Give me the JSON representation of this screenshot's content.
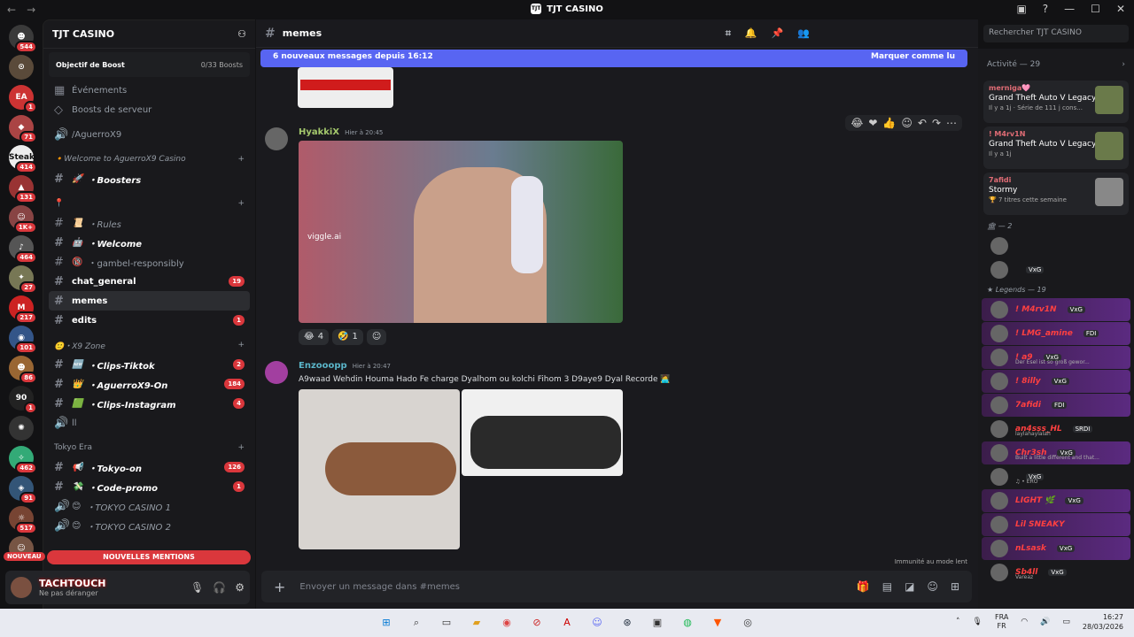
{
  "window": {
    "title": "TJT CASINO"
  },
  "servers": [
    {
      "label": "☻",
      "badge": "544",
      "color": "#3a3a3a"
    },
    {
      "label": "⊙",
      "badge": "",
      "color": "#5a4a3a"
    },
    {
      "label": "EA",
      "badge": "1",
      "color": "#c33"
    },
    {
      "label": "◆",
      "badge": "71",
      "color": "#a44"
    },
    {
      "label": "Steak",
      "badge": "414",
      "color": "#eee"
    },
    {
      "label": "▲",
      "badge": "131",
      "color": "#933"
    },
    {
      "label": "☺",
      "badge": "1K+",
      "color": "#844"
    },
    {
      "label": "♪",
      "badge": "464",
      "color": "#555"
    },
    {
      "label": "✦",
      "badge": "27",
      "color": "#775"
    },
    {
      "label": "M",
      "badge": "217",
      "color": "#c22"
    },
    {
      "label": "◉",
      "badge": "101",
      "color": "#358"
    },
    {
      "label": "☻",
      "badge": "86",
      "color": "#963"
    },
    {
      "label": "90",
      "badge": "1",
      "color": "#222"
    },
    {
      "label": "✺",
      "badge": "",
      "color": "#333"
    },
    {
      "label": "✧",
      "badge": "462",
      "color": "#3a7"
    },
    {
      "label": "◈",
      "badge": "91",
      "color": "#357"
    },
    {
      "label": "☼",
      "badge": "517",
      "color": "#743"
    },
    {
      "label": "☺",
      "badge": "",
      "color": "#754"
    }
  ],
  "guild": {
    "name": "TJT CASINO",
    "boost_label": "Objectif de Boost",
    "boost_count": "0/33 Boosts",
    "events": "Événements",
    "boosts": "Boosts de serveur",
    "voice": "/AguerroX9"
  },
  "sections": [
    {
      "category": "🔸Welcome to AguerroX9 Casino",
      "cat_italic": true,
      "channels": [
        {
          "icon": "🚀",
          "name": "・Boosters",
          "bold": true,
          "italic": true,
          "count": ""
        }
      ]
    },
    {
      "category": "📍",
      "cat_italic": false,
      "channels": [
        {
          "icon": "📜",
          "name": "・Rules",
          "bold": false,
          "italic": true,
          "count": ""
        },
        {
          "icon": "🤖",
          "name": "・Welcome",
          "bold": true,
          "italic": true,
          "count": ""
        },
        {
          "icon": "🔞",
          "name": "・gambel-responsibly",
          "bold": false,
          "italic": false,
          "count": ""
        },
        {
          "icon": "",
          "name": "chat_general",
          "bold": true,
          "italic": false,
          "count": "19"
        },
        {
          "icon": "",
          "name": "memes",
          "bold": true,
          "italic": false,
          "count": "",
          "selected": true
        },
        {
          "icon": "",
          "name": "edits",
          "bold": true,
          "italic": false,
          "count": "1"
        }
      ]
    },
    {
      "category": "🙂・X9 Zone",
      "cat_italic": true,
      "channels": [
        {
          "icon": "🆕",
          "name": "・Clips-Tiktok",
          "bold": true,
          "italic": true,
          "count": "2"
        },
        {
          "icon": "👑",
          "name": "・AguerroX9-On",
          "bold": true,
          "italic": true,
          "count": "184"
        },
        {
          "icon": "🟩",
          "name": "・Clips-Instagram",
          "bold": true,
          "italic": true,
          "count": "4"
        },
        {
          "icon": "",
          "name": "ll",
          "bold": false,
          "italic": false,
          "count": ""
        }
      ]
    },
    {
      "category": "Tokyo Era",
      "cat_italic": false,
      "channels": [
        {
          "icon": "📢",
          "name": "・Tokyo-on",
          "bold": true,
          "italic": true,
          "count": "126"
        },
        {
          "icon": "💸",
          "name": "・Code-promo",
          "bold": true,
          "italic": true,
          "count": "1"
        },
        {
          "icon": "😊",
          "name": "・TOKYO CASINO 1",
          "bold": false,
          "italic": true,
          "count": ""
        },
        {
          "icon": "😊",
          "name": "・TOKYO CASINO 2",
          "bold": false,
          "italic": true,
          "count": ""
        }
      ]
    }
  ],
  "mentions": {
    "nouveau": "NOUVEAU",
    "label": "NOUVELLES MENTIONS"
  },
  "user": {
    "name": "TACHTOUCH",
    "status": "Ne pas déranger"
  },
  "channel": {
    "name": "memes",
    "search_placeholder": "Rechercher TJT CASINO"
  },
  "newbar": {
    "text": "6 nouveaux messages depuis 16:12",
    "action": "Marquer comme lu"
  },
  "messages": [
    {
      "author": "HyakkiX",
      "time": "Hier à 20:45",
      "reactions": [
        {
          "e": "😂",
          "n": "4"
        },
        {
          "e": "🤣",
          "n": "1"
        },
        {
          "e": "☺",
          "n": ""
        }
      ],
      "watermark": "viggle.ai"
    },
    {
      "author": "Enzooopp",
      "time": "Hier à 20:47",
      "text": "A9waad Wehdin Houma Hado Fe charge Dyalhom ou kolchi Fihom 3 D9aye9 Dyal Recorde 🧑‍💻"
    }
  ],
  "composer": {
    "placeholder": "Envoyer un message dans #memes",
    "immunity": "Immunité au mode lent"
  },
  "activity": {
    "header": "Activité — 29",
    "cards": [
      {
        "who": "merniga🩷",
        "title": "Grand Theft Auto V Legacy",
        "sub": "Il y a 1j · Série de 111 j cons...",
        "thumb": "#6a7a4a"
      },
      {
        "who": "! M4rv1N",
        "title": "Grand Theft Auto V Legacy",
        "sub": "Il y a 1j",
        "thumb": "#6a7a4a"
      },
      {
        "who": "7afidi",
        "title": "Stormy",
        "sub": "🏆 7 titres cette semaine",
        "thumb": "#888"
      }
    ]
  },
  "groups": [
    {
      "label": "🏛 — 2",
      "members": [
        {
          "name": "",
          "tag": "",
          "status": ""
        },
        {
          "name": "",
          "tag": "VxG",
          "status": ""
        }
      ]
    },
    {
      "label": "★ Legends — 19",
      "members": [
        {
          "name": "! M4rv1N",
          "tag": "VxG",
          "status": "",
          "hl": true
        },
        {
          "name": "! LMG_amine",
          "tag": "FDI",
          "status": "",
          "hl": true
        },
        {
          "name": "! a9",
          "tag": "VxG",
          "status": "Der Esel ist so groß gewor...",
          "hl": true
        },
        {
          "name": "! 8illy",
          "tag": "VxG",
          "status": "",
          "hl": true
        },
        {
          "name": "7afidi",
          "tag": "FDI",
          "status": "",
          "hl": true
        },
        {
          "name": "an4sss_HL",
          "tag": "SRDI",
          "status": "laylahaylalah",
          "hl": false
        },
        {
          "name": "Chr3sh",
          "tag": "VxG",
          "status": "Built a little different and that...",
          "hl": true
        },
        {
          "name": "",
          "tag": "VxG",
          "status": "♫ • ERO",
          "hl": false
        },
        {
          "name": "LIGHT 🌿",
          "tag": "VxG",
          "status": "",
          "hl": true
        },
        {
          "name": "Lil SNEAKY",
          "tag": "",
          "status": "",
          "hl": true
        },
        {
          "name": "nLsask",
          "tag": "VxG",
          "status": "",
          "hl": true
        },
        {
          "name": "Sb4ll",
          "tag": "VxG",
          "status": "Vareaz",
          "hl": false
        }
      ]
    }
  ],
  "taskbar": {
    "lang1": "FRA",
    "lang2": "FR",
    "time": "16:27",
    "date": "28/03/2026"
  }
}
